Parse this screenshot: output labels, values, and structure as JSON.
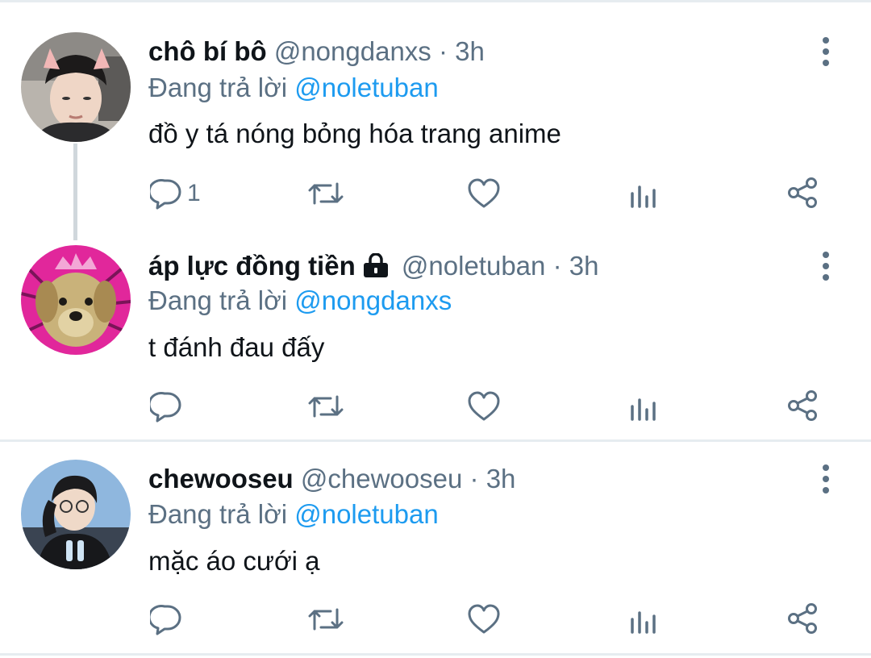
{
  "colors": {
    "accent": "#1d9bf0",
    "muted": "#5b7083",
    "text": "#0f1419",
    "separator": "#e6ecf0"
  },
  "tweets": [
    {
      "name": "chô bí bô",
      "handle": "@nongdanxs",
      "dot": "·",
      "time": "3h",
      "reply_prefix": "Đang trả lời",
      "reply_to": "@noletuban",
      "text": "đồ y tá nóng bỏng hóa trang anime",
      "reply_count": "1",
      "locked": false
    },
    {
      "name": "áp lực đồng tiền",
      "handle": "@noletuban",
      "dot": "·",
      "time": "3h",
      "reply_prefix": "Đang trả lời",
      "reply_to": "@nongdanxs",
      "text": "t đánh đau đấy",
      "reply_count": "",
      "locked": true
    },
    {
      "name": "chewooseu",
      "handle": "@chewooseu",
      "dot": "·",
      "time": "3h",
      "reply_prefix": "Đang trả lời",
      "reply_to": "@noletuban",
      "text": "mặc áo cưới ạ",
      "reply_count": "",
      "locked": false
    }
  ],
  "icons": [
    "reply-icon",
    "retweet-icon",
    "like-icon",
    "analytics-icon",
    "share-icon",
    "more-icon",
    "lock-icon"
  ]
}
